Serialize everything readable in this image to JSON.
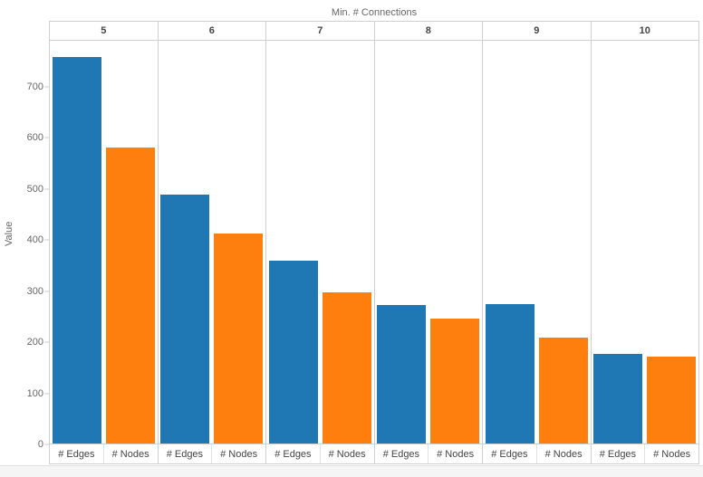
{
  "chart_data": {
    "type": "bar",
    "title": "",
    "column_header_label": "Min. # Connections",
    "categories": [
      "5",
      "6",
      "7",
      "8",
      "9",
      "10"
    ],
    "series": [
      {
        "name": "# Edges",
        "color": "#1f77b4",
        "values": [
          758,
          488,
          358,
          272,
          274,
          176
        ]
      },
      {
        "name": "# Nodes",
        "color": "#ff7f0e",
        "values": [
          581,
          412,
          297,
          245,
          208,
          170
        ]
      }
    ],
    "xlabel": "Min. # Connections",
    "ylabel": "Value",
    "ylim": [
      0,
      790
    ],
    "y_ticks": [
      0,
      100,
      200,
      300,
      400,
      500,
      600,
      700
    ],
    "grid": false,
    "legend_position": "none",
    "measure_labels": [
      "# Edges",
      "# Nodes"
    ]
  },
  "axis": {
    "y_title": "Value",
    "y_tick_labels": [
      "700",
      "600",
      "500",
      "400",
      "300",
      "200",
      "100",
      "0"
    ]
  },
  "header": {
    "title": "Min. # Connections"
  }
}
